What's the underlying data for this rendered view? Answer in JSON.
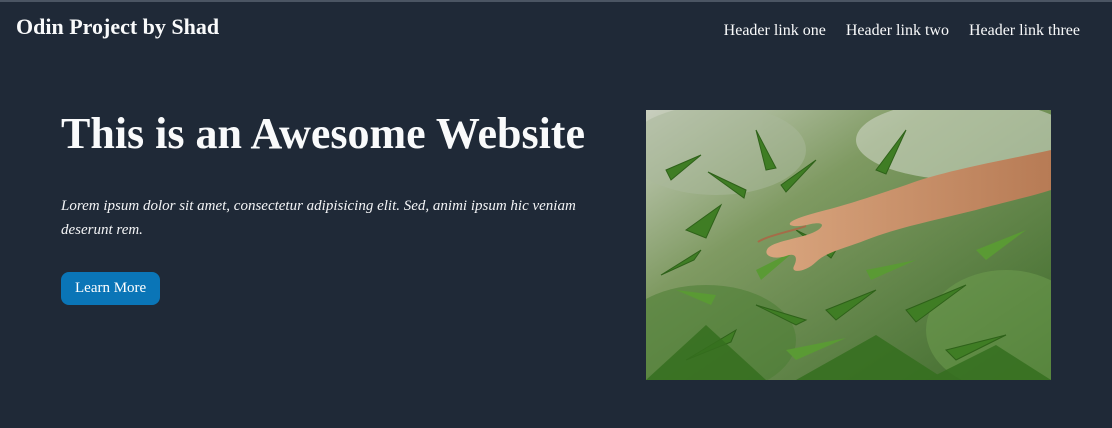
{
  "header": {
    "site_title": "Odin Project by Shad",
    "links": [
      {
        "label": "Header link one"
      },
      {
        "label": "Header link two"
      },
      {
        "label": "Header link three"
      }
    ]
  },
  "hero": {
    "title": "This is an Awesome Website",
    "description": "Lorem ipsum dolor sit amet, consectetur adipisicing elit. Sed, animi ipsum hic veniam deserunt rem.",
    "button_label": "Learn More",
    "image_icon": "hand-touching-cannabis-plant-photo"
  },
  "colors": {
    "background": "#1f2937",
    "text": "#f9fafb",
    "button": "#0a75b7"
  }
}
